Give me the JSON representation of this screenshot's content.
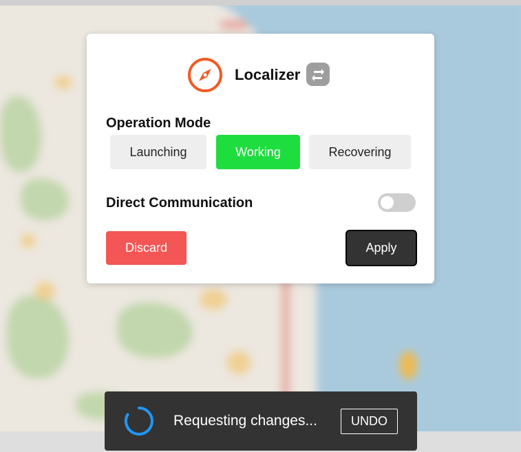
{
  "app": {
    "title": "Localizer"
  },
  "card": {
    "operation_mode_label": "Operation Mode",
    "modes": [
      {
        "label": "Launching",
        "selected": false
      },
      {
        "label": "Working",
        "selected": true
      },
      {
        "label": "Recovering",
        "selected": false
      }
    ],
    "direct_communication_label": "Direct Communication",
    "direct_communication_enabled": false,
    "discard_label": "Discard",
    "apply_label": "Apply"
  },
  "snackbar": {
    "message": "Requesting changes...",
    "undo_label": "UNDO"
  },
  "icons": {
    "logo": "compass-icon",
    "sync": "sync-icon",
    "spinner": "loading-spinner-icon"
  },
  "colors": {
    "accent": "#f15a24",
    "selected_mode": "#1edd3f",
    "discard": "#f45555",
    "apply": "#333333",
    "spinner": "#2196f3",
    "snackbar": "#333333"
  }
}
